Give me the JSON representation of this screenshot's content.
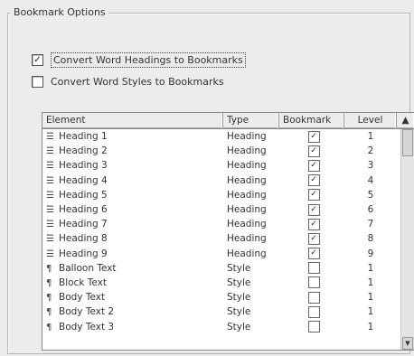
{
  "group": {
    "title": "Bookmark Options"
  },
  "options": [
    {
      "label": "Convert Word Headings to Bookmarks",
      "checked": true
    },
    {
      "label": "Convert Word Styles to Bookmarks",
      "checked": false
    }
  ],
  "table": {
    "columns": [
      "Element",
      "Type",
      "Bookmark",
      "Level"
    ],
    "sort_indicator": "▲",
    "rows": [
      {
        "element": "Heading 1",
        "type": "Heading",
        "bookmark": true,
        "level": "1"
      },
      {
        "element": "Heading 2",
        "type": "Heading",
        "bookmark": true,
        "level": "2"
      },
      {
        "element": "Heading 3",
        "type": "Heading",
        "bookmark": true,
        "level": "3"
      },
      {
        "element": "Heading 4",
        "type": "Heading",
        "bookmark": true,
        "level": "4"
      },
      {
        "element": "Heading 5",
        "type": "Heading",
        "bookmark": true,
        "level": "5"
      },
      {
        "element": "Heading 6",
        "type": "Heading",
        "bookmark": true,
        "level": "6"
      },
      {
        "element": "Heading 7",
        "type": "Heading",
        "bookmark": true,
        "level": "7"
      },
      {
        "element": "Heading 8",
        "type": "Heading",
        "bookmark": true,
        "level": "8"
      },
      {
        "element": "Heading 9",
        "type": "Heading",
        "bookmark": true,
        "level": "9"
      },
      {
        "element": "Balloon Text",
        "type": "Style",
        "bookmark": false,
        "level": "1"
      },
      {
        "element": "Block Text",
        "type": "Style",
        "bookmark": false,
        "level": "1"
      },
      {
        "element": "Body Text",
        "type": "Style",
        "bookmark": false,
        "level": "1"
      },
      {
        "element": "Body Text 2",
        "type": "Style",
        "bookmark": false,
        "level": "1"
      },
      {
        "element": "Body Text 3",
        "type": "Style",
        "bookmark": false,
        "level": "1"
      }
    ]
  },
  "icons": {
    "heading": "heading-lines-icon",
    "style": "pilcrow-icon",
    "check": "checkmark-icon"
  },
  "colors": {
    "background": "#ececec",
    "table_bg": "#ffffff"
  }
}
